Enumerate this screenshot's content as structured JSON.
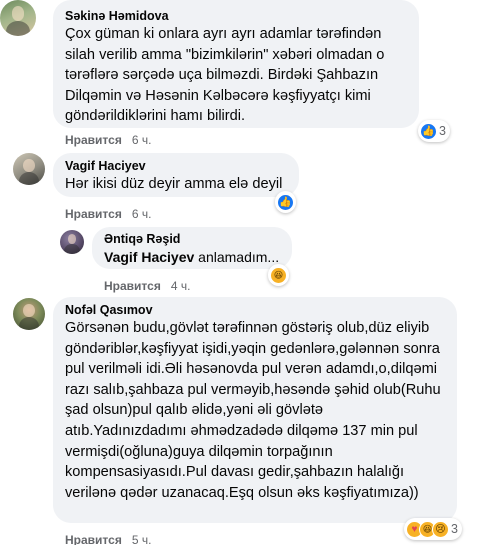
{
  "comments": [
    {
      "author": "Səkinə Həmidova",
      "text": "Çox güman ki onlara ayrı ayrı adamlar tərəfindən silah verilib amma \"bizimkilərin\" xəbəri olmadan o tərəflərə sərçədə uça bilməzdi. Birdəki Şahbazın Dilqəmin və Həsənin Kəlbəcərə kəşfiyyatçı kimi göndərildiklərini hamı bilirdi.",
      "like_label": "Нравится",
      "time": "6 ч.",
      "reaction_count": "3",
      "reactions": [
        "like-icon"
      ]
    },
    {
      "author": "Vagif Haciyev",
      "text": "Hər ikisi düz deyir amma elə deyil",
      "like_label": "Нравится",
      "time": "6 ч.",
      "reactions": [
        "like-icon"
      ]
    },
    {
      "author": "Əntiqə Rəşid",
      "mention": "Vagif Haciyev",
      "text": " anlamadım...",
      "like_label": "Нравится",
      "time": "4 ч.",
      "reactions": [
        "haha-icon"
      ]
    },
    {
      "author": "Nofəl Qasımov",
      "text": "Görsənən budu,gövlət tərəfinnən göstəriş olub,düz eliyib göndəriblər,kəşfiyyat işidi,yəqin gedənlərə,gələnnən sonra pul verilməli idi.Əli həsənovda pul verən adamdı,o,dilqəmi razı salıb,şahbaza pul verməyib,həsəndə şəhid olub(Ruhu şad olsun)pul qalıb əlidə,yəni əli gövlətə atıb.Yadınızdadımı əhmədzadədə dilqəmə 137 min pul vermişdi(oğluna)guya dilqəmin torpağının kompensasiyasıdı.Pul davası gedir,şahbazın halalığı verilənə qədər uzanacaq.Eşq olsun əks kəşfiyatımıza))",
      "like_label": "Нравится",
      "time": "5 ч.",
      "reaction_count": "3",
      "reactions": [
        "care-icon",
        "haha-icon",
        "sad-icon"
      ]
    }
  ]
}
